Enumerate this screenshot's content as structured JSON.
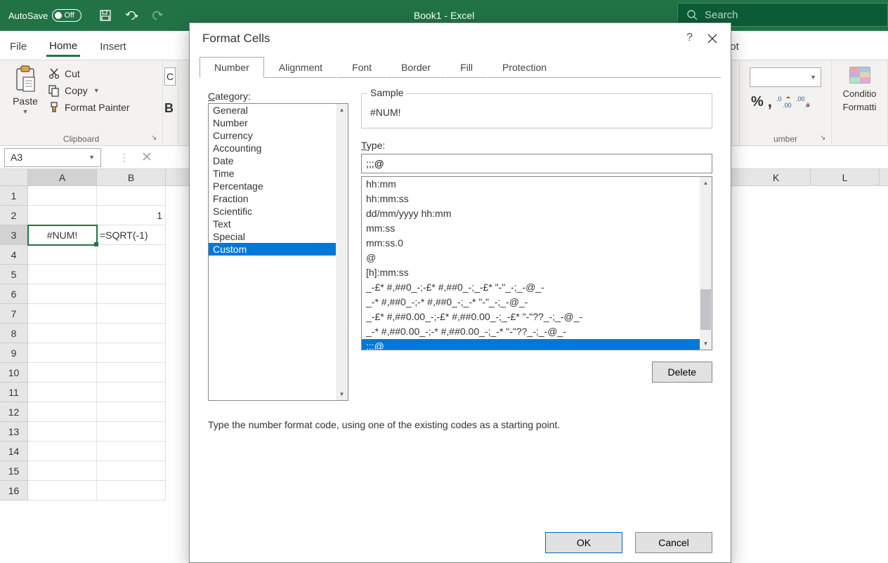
{
  "titlebar": {
    "autosave_label": "AutoSave",
    "autosave_state": "Off",
    "document_title": "Book1 - Excel",
    "search_placeholder": "Search"
  },
  "ribbon": {
    "tabs": {
      "file": "File",
      "home": "Home",
      "insert": "Insert",
      "power_pivot": "Power Pivot"
    },
    "clipboard": {
      "paste": "Paste",
      "cut": "Cut",
      "copy": "Copy",
      "format_painter": "Format Painter",
      "group_label": "Clipboard"
    },
    "number": {
      "group_label": "umber",
      "percent": "%",
      "comma": ",",
      "inc_dec_left": ".0",
      "inc_dec_right": ".00"
    },
    "styles": {
      "conditional_top": "Conditio",
      "conditional_bot": "Formatti"
    }
  },
  "formula_bar": {
    "name_box": "A3"
  },
  "grid": {
    "columns": [
      "A",
      "B",
      "K",
      "L"
    ],
    "cell_b2": "1",
    "cell_a3": "#NUM!",
    "cell_b3": "=SQRT(-1)"
  },
  "dialog": {
    "title": "Format Cells",
    "tabs": [
      "Number",
      "Alignment",
      "Font",
      "Border",
      "Fill",
      "Protection"
    ],
    "active_tab": "Number",
    "category_label": "Category:",
    "categories": [
      "General",
      "Number",
      "Currency",
      "Accounting",
      "Date",
      "Time",
      "Percentage",
      "Fraction",
      "Scientific",
      "Text",
      "Special",
      "Custom"
    ],
    "selected_category": "Custom",
    "sample_label": "Sample",
    "sample_value": "#NUM!",
    "type_label": "Type:",
    "type_value": ";;;@",
    "type_list": [
      "hh:mm",
      "hh:mm:ss",
      "dd/mm/yyyy hh:mm",
      "mm:ss",
      "mm:ss.0",
      "@",
      "[h]:mm:ss",
      "_-£* #,##0_-;-£* #,##0_-;_-£* \"-\"_-;_-@_-",
      "_-* #,##0_-;-* #,##0_-;_-* \"-\"_-;_-@_-",
      "_-£* #,##0.00_-;-£* #,##0.00_-;_-£* \"-\"??_-;_-@_-",
      "_-* #,##0.00_-;-* #,##0.00_-;_-* \"-\"??_-;_-@_-",
      ";;;@"
    ],
    "selected_type": ";;;@",
    "delete_btn": "Delete",
    "help_text": "Type the number format code, using one of the existing codes as a starting point.",
    "ok_btn": "OK",
    "cancel_btn": "Cancel"
  }
}
